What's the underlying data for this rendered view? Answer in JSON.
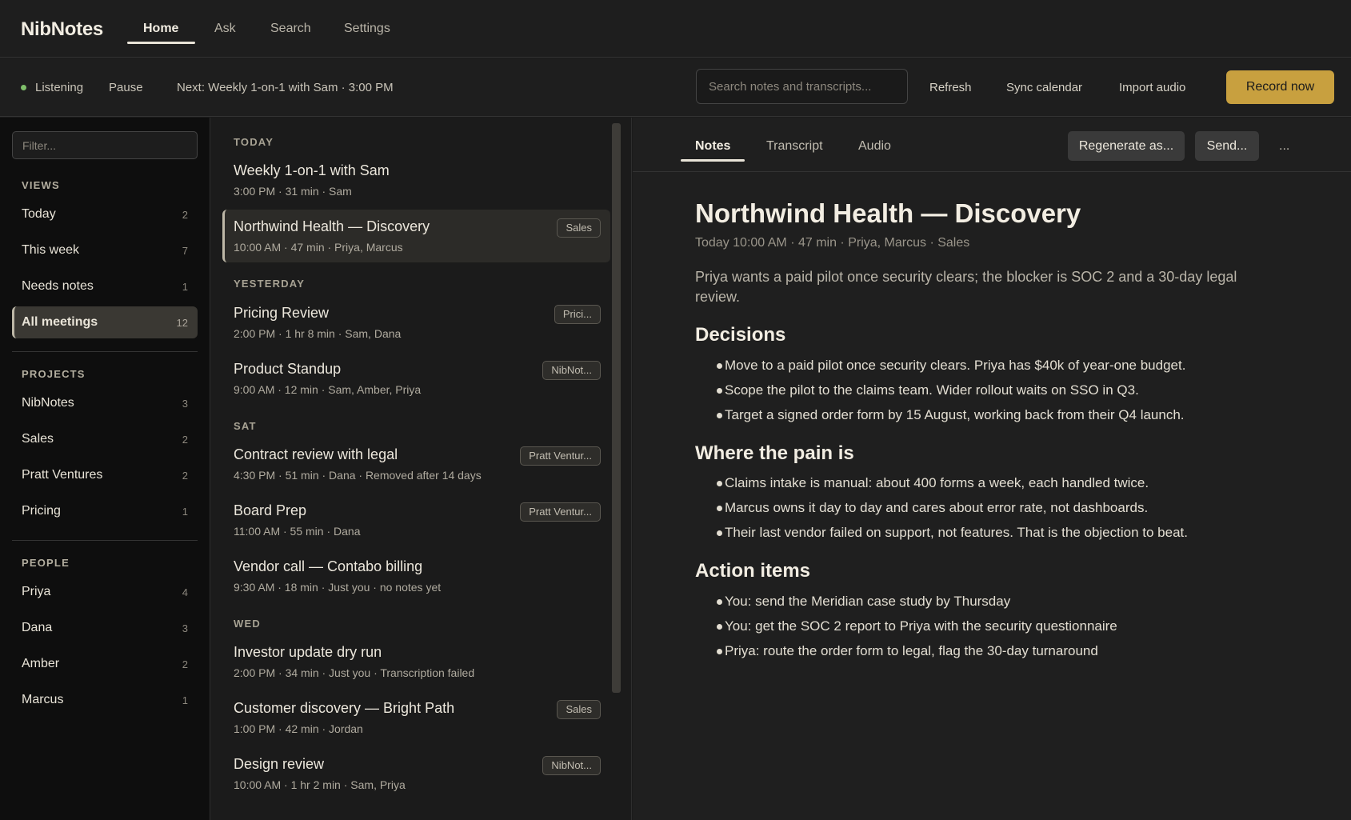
{
  "app": {
    "brand": "NibNotes",
    "nav": [
      "Home",
      "Ask",
      "Search",
      "Settings"
    ]
  },
  "toolbar": {
    "status": "Listening",
    "pause": "Pause",
    "next": "Next: Weekly 1-on-1 with Sam · 3:00 PM",
    "search_placeholder": "Search notes and transcripts...",
    "refresh": "Refresh",
    "sync": "Sync calendar",
    "import": "Import audio",
    "record": "Record now",
    "status_color": "#7fbf6a",
    "accent": "#c8a03f"
  },
  "sidebar": {
    "filter_placeholder": "Filter...",
    "views_head": "VIEWS",
    "views": [
      {
        "label": "Today",
        "count": "2"
      },
      {
        "label": "This week",
        "count": "7"
      },
      {
        "label": "Needs notes",
        "count": "1"
      },
      {
        "label": "All meetings",
        "count": "12"
      }
    ],
    "projects_head": "PROJECTS",
    "projects": [
      {
        "label": "NibNotes",
        "count": "3"
      },
      {
        "label": "Sales",
        "count": "2"
      },
      {
        "label": "Pratt Ventures",
        "count": "2"
      },
      {
        "label": "Pricing",
        "count": "1"
      }
    ],
    "people_head": "PEOPLE",
    "people": [
      {
        "label": "Priya",
        "count": "4"
      },
      {
        "label": "Dana",
        "count": "3"
      },
      {
        "label": "Amber",
        "count": "2"
      },
      {
        "label": "Marcus",
        "count": "1"
      }
    ]
  },
  "list": {
    "days": [
      "TODAY",
      "YESTERDAY",
      "SAT",
      "WED"
    ],
    "meetings": [
      {
        "title": "Weekly 1-on-1 with Sam",
        "meta": "3:00 PM  ·  31 min  ·  Sam",
        "tag": ""
      },
      {
        "title": "Northwind Health — Discovery",
        "meta": "10:00 AM  ·  47 min  ·  Priya, Marcus",
        "tag": "Sales"
      },
      {
        "title": "Pricing Review",
        "meta": "2:00 PM  ·  1 hr 8 min  ·  Sam, Dana",
        "tag": "Prici..."
      },
      {
        "title": "Product Standup",
        "meta": "9:00 AM  ·  12 min  ·  Sam, Amber, Priya",
        "tag": "NibNot..."
      },
      {
        "title": "Contract review with legal",
        "meta": "4:30 PM  ·  51 min  ·  Dana  ·  Removed after 14 days",
        "tag": "Pratt Ventur..."
      },
      {
        "title": "Board Prep",
        "meta": "11:00 AM  ·  55 min  ·  Dana",
        "tag": "Pratt Ventur..."
      },
      {
        "title": "Vendor call — Contabo billing",
        "meta": "9:30 AM  ·  18 min  ·  Just you  ·  no notes yet",
        "tag": ""
      },
      {
        "title": "Investor update dry run",
        "meta": "2:00 PM  ·  34 min  ·  Just you  ·  Transcription failed",
        "tag": ""
      },
      {
        "title": "Customer discovery — Bright Path",
        "meta": "1:00 PM  ·  42 min  ·  Jordan",
        "tag": "Sales"
      },
      {
        "title": "Design review",
        "meta": "10:00 AM  ·  1 hr 2 min  ·  Sam, Priya",
        "tag": "NibNot..."
      }
    ]
  },
  "detail": {
    "tabs": [
      "Notes",
      "Transcript",
      "Audio"
    ],
    "regenerate": "Regenerate as...",
    "send": "Send...",
    "more": "...",
    "title": "Northwind Health — Discovery",
    "meta": "Today 10:00 AM · 47 min · Priya, Marcus · Sales",
    "summary": "Priya wants a paid pilot once security clears; the blocker is SOC 2 and a 30-day legal review.",
    "sections": [
      {
        "heading": "Decisions",
        "bullets": [
          "Move to a paid pilot once security clears. Priya has $40k of year-one budget.",
          "Scope the pilot to the claims team. Wider rollout waits on SSO in Q3.",
          "Target a signed order form by 15 August, working back from their Q4 launch."
        ]
      },
      {
        "heading": "Where the pain is",
        "bullets": [
          "Claims intake is manual: about 400 forms a week, each handled twice.",
          "Marcus owns it day to day and cares about error rate, not dashboards.",
          "Their last vendor failed on support, not features. That is the objection to beat."
        ]
      },
      {
        "heading": "Action items",
        "bullets": [
          "You: send the Meridian case study by Thursday",
          "You: get the SOC 2 report to Priya with the security questionnaire",
          "Priya: route the order form to legal, flag the 30-day turnaround"
        ]
      }
    ]
  }
}
